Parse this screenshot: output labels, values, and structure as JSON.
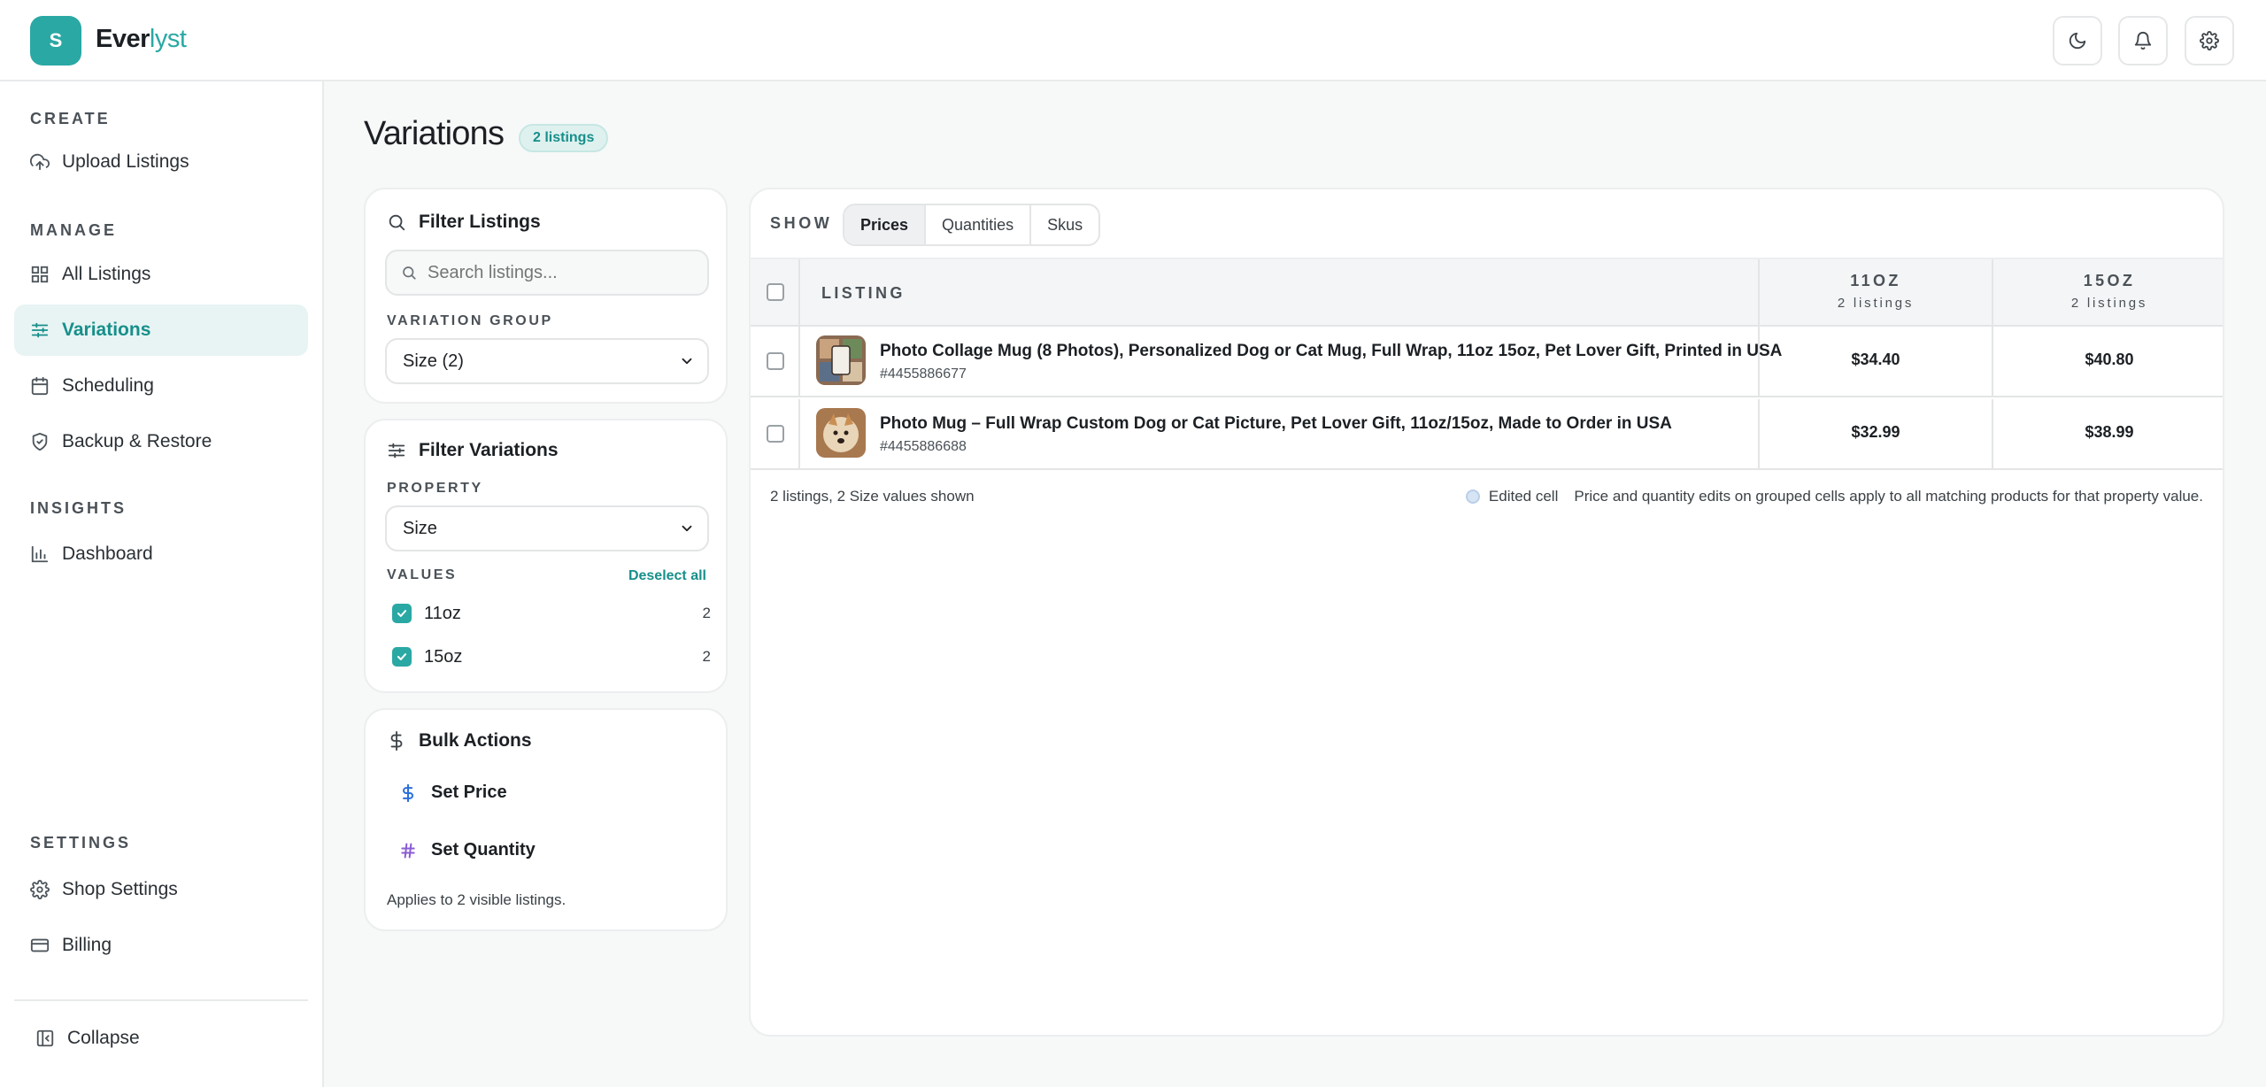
{
  "app": {
    "logo_letter": "S",
    "brand_main": "Ever",
    "brand_accent": "lyst",
    "accent_color": "#2aa8a4"
  },
  "header": {
    "icons": [
      "moon-icon",
      "bell-icon",
      "gear-icon"
    ]
  },
  "sidebar": {
    "sections": [
      {
        "title": "CREATE",
        "items": [
          {
            "label": "Upload Listings",
            "icon": "upload-cloud-icon"
          }
        ]
      },
      {
        "title": "MANAGE",
        "items": [
          {
            "label": "All Listings",
            "icon": "grid-icon"
          },
          {
            "label": "Variations",
            "icon": "sliders-icon",
            "active": true
          },
          {
            "label": "Scheduling",
            "icon": "calendar-icon"
          },
          {
            "label": "Backup & Restore",
            "icon": "shield-icon"
          }
        ]
      },
      {
        "title": "INSIGHTS",
        "items": [
          {
            "label": "Dashboard",
            "icon": "bar-chart-icon"
          }
        ]
      },
      {
        "title": "SETTINGS",
        "items": [
          {
            "label": "Shop Settings",
            "icon": "gear-icon"
          },
          {
            "label": "Billing",
            "icon": "credit-card-icon"
          }
        ]
      }
    ],
    "collapse_label": "Collapse"
  },
  "page": {
    "title": "Variations",
    "badge": "2 listings"
  },
  "filter_listings": {
    "title": "Filter Listings",
    "search_placeholder": "Search listings...",
    "group_label": "VARIATION GROUP",
    "group_value": "Size (2)"
  },
  "filter_variations": {
    "title": "Filter Variations",
    "property_label": "PROPERTY",
    "property_value": "Size",
    "values_label": "VALUES",
    "deselect_label": "Deselect all",
    "values": [
      {
        "label": "11oz",
        "count": "2",
        "checked": true
      },
      {
        "label": "15oz",
        "count": "2",
        "checked": true
      }
    ]
  },
  "bulk_actions": {
    "title": "Bulk Actions",
    "set_price": "Set Price",
    "set_quantity": "Set Quantity",
    "note": "Applies to 2 visible listings."
  },
  "table": {
    "show_label": "SHOW",
    "tabs": [
      {
        "label": "Prices",
        "active": true
      },
      {
        "label": "Quantities"
      },
      {
        "label": "Skus"
      }
    ],
    "col_listing": "LISTING",
    "columns": [
      {
        "title": "11OZ",
        "sub": "2 listings"
      },
      {
        "title": "15OZ",
        "sub": "2 listings"
      }
    ],
    "rows": [
      {
        "title": "Photo Collage Mug (8 Photos), Personalized Dog or Cat Mug, Full Wrap, 11oz 15oz, Pet Lover Gift, Printed in USA",
        "id": "#4455886677",
        "prices": [
          "$34.40",
          "$40.80"
        ]
      },
      {
        "title": "Photo Mug – Full Wrap Custom Dog or Cat Picture, Pet Lover Gift, 11oz/15oz, Made to Order in USA",
        "id": "#4455886688",
        "prices": [
          "$32.99",
          "$38.99"
        ]
      }
    ],
    "footer_left": "2 listings, 2 Size values shown",
    "legend_label": "Edited cell",
    "footer_note": "Price and quantity edits on grouped cells apply to all matching products for that property value."
  }
}
